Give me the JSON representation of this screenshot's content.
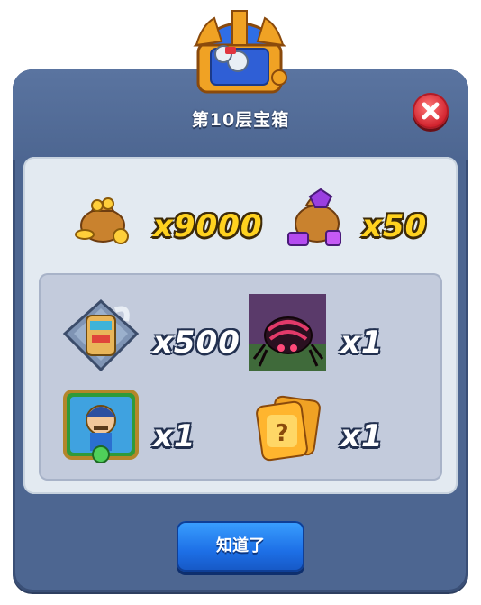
{
  "dialog": {
    "title": "第10层宝箱",
    "confirm_label": "知道了",
    "close_icon": "close-icon"
  },
  "rewards": {
    "top": [
      {
        "icon": "gold-coin-sack-icon",
        "quantity": "x9000"
      },
      {
        "icon": "purple-gem-sack-icon",
        "quantity": "x50"
      }
    ],
    "bonus": [
      {
        "icon": "hero-mask-shard-icon",
        "quantity": "x500"
      },
      {
        "icon": "spider-monster-card-icon",
        "quantity": "x1"
      },
      {
        "icon": "hero-portrait-card-icon",
        "quantity": "x1"
      },
      {
        "icon": "mystery-card-icon",
        "quantity": "x1"
      }
    ]
  },
  "colors": {
    "panel": "#4d6691",
    "content": "#e3eaf1",
    "inner": "#c3cbdc",
    "gold_text": "#ffd21f",
    "button": "#1d6fe6",
    "close": "#d2242f"
  }
}
